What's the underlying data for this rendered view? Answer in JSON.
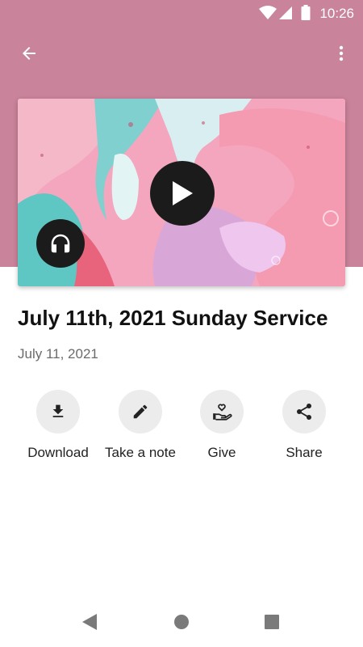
{
  "status_bar": {
    "time": "10:26",
    "icons": [
      "wifi-icon",
      "signal-icon",
      "battery-icon"
    ]
  },
  "toolbar": {
    "back_icon": "arrow-left-icon",
    "more_icon": "more-vertical-icon"
  },
  "theme": {
    "header_color": "#c9839a",
    "button_dark": "#1b1b1b",
    "action_circle": "#ececec"
  },
  "media": {
    "play_icon": "play-icon",
    "audio_icon": "headphones-icon"
  },
  "sermon": {
    "title": "July 11th, 2021 Sunday Service",
    "date": "July 11, 2021"
  },
  "actions": [
    {
      "label": "Download",
      "icon": "download-icon"
    },
    {
      "label": "Take a note",
      "icon": "pencil-icon"
    },
    {
      "label": "Give",
      "icon": "give-hand-heart-icon"
    },
    {
      "label": "Share",
      "icon": "share-icon"
    }
  ],
  "nav_bar": {
    "icons": [
      "back-triangle-icon",
      "home-circle-icon",
      "recents-square-icon"
    ]
  }
}
